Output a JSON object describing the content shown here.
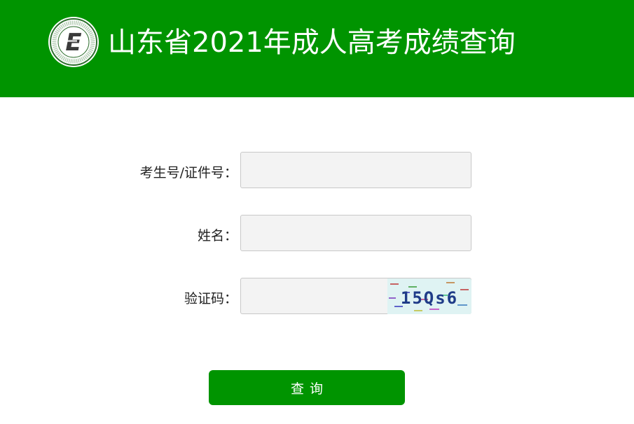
{
  "header": {
    "title": "山东省2021年成人高考成绩查询",
    "logo_icon": "shandong-admissions-logo",
    "logo_letter": "E",
    "background_color": "#009400"
  },
  "form": {
    "exam_id": {
      "label": "考生号/证件号：",
      "value": "",
      "placeholder": ""
    },
    "name": {
      "label": "姓名：",
      "value": "",
      "placeholder": ""
    },
    "captcha": {
      "label": "验证码：",
      "value": "",
      "placeholder": "",
      "image_icon": "captcha-image",
      "image_text": "15Qs6"
    },
    "submit_label": "查询"
  }
}
